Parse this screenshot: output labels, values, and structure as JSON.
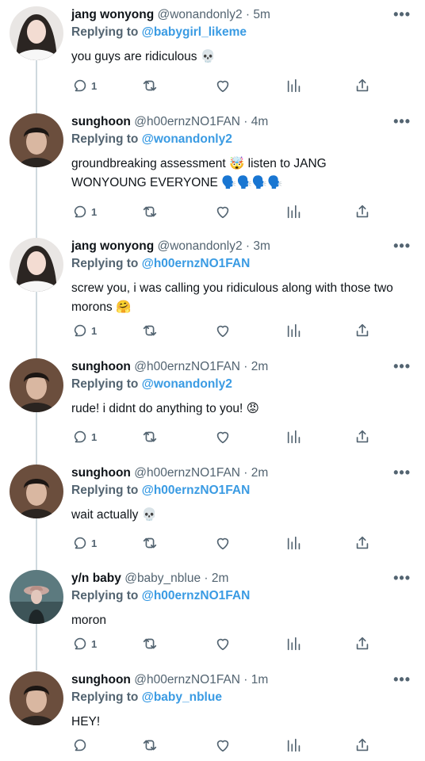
{
  "replying_prefix": "Replying to",
  "tweets": [
    {
      "name": "jang wonyong",
      "handle": "@wonandonly2 · 5m",
      "reply_to": "@babygirl_likeme",
      "text": "you guys are ridiculous 💀",
      "reply_count": "1",
      "avatar": "girl",
      "more": "•••"
    },
    {
      "name": "sunghoon",
      "handle": "@h00ernzNO1FAN · 4m",
      "reply_to": "@wonandonly2",
      "text": "groundbreaking assessment 🤯 listen to JANG WONYOUNG EVERYONE 🗣️🗣️🗣️🗣️",
      "reply_count": "1",
      "avatar": "boy",
      "more": "•••"
    },
    {
      "name": "jang wonyong",
      "handle": "@wonandonly2 · 3m",
      "reply_to": "@h00ernzNO1FAN",
      "text": "screw you, i was calling you ridiculous along with those two morons 🤗",
      "reply_count": "1",
      "avatar": "girl",
      "more": "•••"
    },
    {
      "name": "sunghoon",
      "handle": "@h00ernzNO1FAN · 2m",
      "reply_to": "@wonandonly2",
      "text": "rude! i didnt do anything to you! 😡",
      "reply_count": "1",
      "avatar": "boy",
      "more": "•••"
    },
    {
      "name": "sunghoon",
      "handle": "@h00ernzNO1FAN · 2m",
      "reply_to": "@h00ernzNO1FAN",
      "text": "wait actually 💀",
      "reply_count": "1",
      "avatar": "boy",
      "more": "•••"
    },
    {
      "name": "y/n baby",
      "handle": "@baby_nblue · 2m",
      "reply_to": "@h00ernzNO1FAN",
      "text": "moron",
      "reply_count": "1",
      "avatar": "hat",
      "more": "•••"
    },
    {
      "name": "sunghoon",
      "handle": "@h00ernzNO1FAN · 1m",
      "reply_to": "@baby_nblue",
      "text": "HEY!",
      "reply_count": "",
      "avatar": "boy",
      "more": "•••"
    }
  ],
  "colors": {
    "text": "#0f1419",
    "muted": "#536471",
    "link": "#3a9be3",
    "line": "#cfd9de"
  },
  "icons": [
    "reply-icon",
    "retweet-icon",
    "like-icon",
    "stats-icon",
    "share-icon",
    "more-icon"
  ]
}
